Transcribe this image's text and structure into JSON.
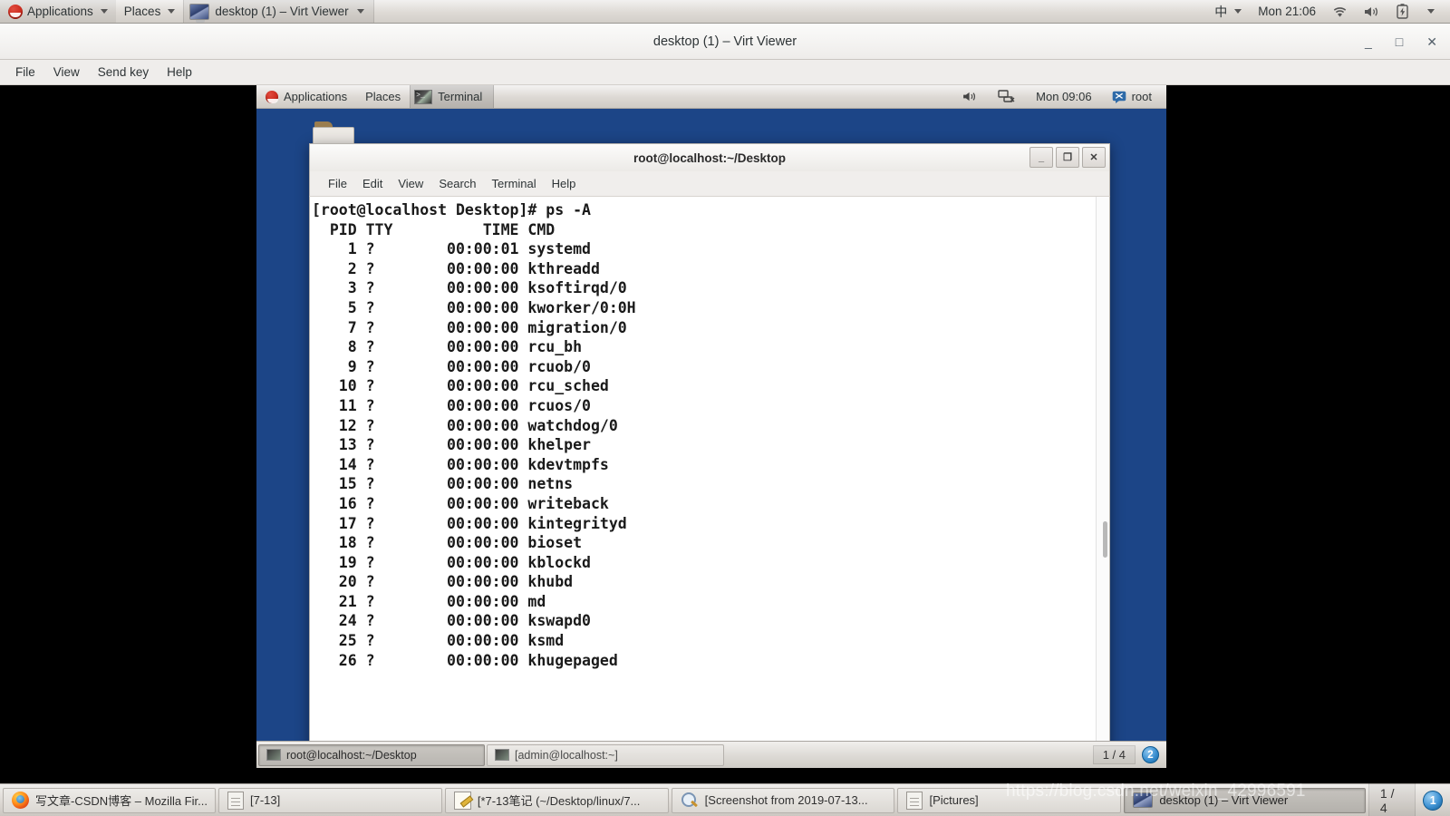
{
  "host_panel": {
    "logo": "redhat-logo",
    "applications": "Applications",
    "places": "Places",
    "window_task": "desktop (1) – Virt Viewer",
    "input_method": "中",
    "clock": "Mon 21:06",
    "icons": [
      "wifi-icon",
      "volume-icon",
      "battery-icon",
      "chevron-down-icon"
    ]
  },
  "virt_viewer": {
    "title": "desktop (1) – Virt Viewer",
    "window_buttons": {
      "minimize": "_",
      "maximize": "□",
      "close": "✕"
    },
    "menu": [
      "File",
      "View",
      "Send key",
      "Help"
    ]
  },
  "vm_panel": {
    "applications": "Applications",
    "places": "Places",
    "window_task": "Terminal",
    "clock": "Mon 09:06",
    "user": "root",
    "icons": [
      "volume-icon",
      "network-disconnected-icon",
      "user-chat-icon"
    ]
  },
  "vm_desktop": {
    "folder_label": ""
  },
  "terminal": {
    "title": "root@localhost:~/Desktop",
    "window_buttons": {
      "minimize": "_",
      "maximize": "❐",
      "close": "✕"
    },
    "menu": [
      "File",
      "Edit",
      "View",
      "Search",
      "Terminal",
      "Help"
    ],
    "prompt_line": "[root@localhost Desktop]# ps -A",
    "header_line": "  PID TTY          TIME CMD",
    "rows": [
      {
        "pid": "1",
        "tty": "?",
        "time": "00:00:01",
        "cmd": "systemd"
      },
      {
        "pid": "2",
        "tty": "?",
        "time": "00:00:00",
        "cmd": "kthreadd"
      },
      {
        "pid": "3",
        "tty": "?",
        "time": "00:00:00",
        "cmd": "ksoftirqd/0"
      },
      {
        "pid": "5",
        "tty": "?",
        "time": "00:00:00",
        "cmd": "kworker/0:0H"
      },
      {
        "pid": "7",
        "tty": "?",
        "time": "00:00:00",
        "cmd": "migration/0"
      },
      {
        "pid": "8",
        "tty": "?",
        "time": "00:00:00",
        "cmd": "rcu_bh"
      },
      {
        "pid": "9",
        "tty": "?",
        "time": "00:00:00",
        "cmd": "rcuob/0"
      },
      {
        "pid": "10",
        "tty": "?",
        "time": "00:00:00",
        "cmd": "rcu_sched"
      },
      {
        "pid": "11",
        "tty": "?",
        "time": "00:00:00",
        "cmd": "rcuos/0"
      },
      {
        "pid": "12",
        "tty": "?",
        "time": "00:00:00",
        "cmd": "watchdog/0"
      },
      {
        "pid": "13",
        "tty": "?",
        "time": "00:00:00",
        "cmd": "khelper"
      },
      {
        "pid": "14",
        "tty": "?",
        "time": "00:00:00",
        "cmd": "kdevtmpfs"
      },
      {
        "pid": "15",
        "tty": "?",
        "time": "00:00:00",
        "cmd": "netns"
      },
      {
        "pid": "16",
        "tty": "?",
        "time": "00:00:00",
        "cmd": "writeback"
      },
      {
        "pid": "17",
        "tty": "?",
        "time": "00:00:00",
        "cmd": "kintegrityd"
      },
      {
        "pid": "18",
        "tty": "?",
        "time": "00:00:00",
        "cmd": "bioset"
      },
      {
        "pid": "19",
        "tty": "?",
        "time": "00:00:00",
        "cmd": "kblockd"
      },
      {
        "pid": "20",
        "tty": "?",
        "time": "00:00:00",
        "cmd": "khubd"
      },
      {
        "pid": "21",
        "tty": "?",
        "time": "00:00:00",
        "cmd": "md"
      },
      {
        "pid": "24",
        "tty": "?",
        "time": "00:00:00",
        "cmd": "kswapd0"
      },
      {
        "pid": "25",
        "tty": "?",
        "time": "00:00:00",
        "cmd": "ksmd"
      },
      {
        "pid": "26",
        "tty": "?",
        "time": "00:00:00",
        "cmd": "khugepaged"
      }
    ]
  },
  "vm_taskbar": {
    "items": [
      {
        "label": "root@localhost:~/Desktop",
        "active": true
      },
      {
        "label": "[admin@localhost:~]",
        "active": false
      }
    ],
    "workspace": "1 / 4",
    "workspace_badge": "2"
  },
  "host_taskbar": {
    "items": [
      {
        "label": "写文章-CSDN博客 – Mozilla Fir...",
        "icon": "firefox-icon"
      },
      {
        "label": "[7-13]",
        "icon": "file-manager-icon"
      },
      {
        "label": "[*7-13笔记 (~/Desktop/linux/7...",
        "icon": "text-editor-icon"
      },
      {
        "label": "[Screenshot from 2019-07-13...",
        "icon": "image-viewer-icon"
      },
      {
        "label": "[Pictures]",
        "icon": "file-manager-icon"
      },
      {
        "label": "desktop (1) – Virt Viewer",
        "icon": "monitor-icon",
        "selected": true
      }
    ],
    "workspace": "1 / 4",
    "workspace_badge": "1"
  },
  "watermark": {
    "text": "https://blog.csdn.net/weixin_42996591"
  },
  "colors": {
    "vm_desktop_bg": "#1c4587",
    "panel_bg": "#dcd8d3",
    "terminal_bg": "#ffffff",
    "terminal_fg": "#1a1a1a",
    "accent_blue": "#3a8fd0"
  }
}
